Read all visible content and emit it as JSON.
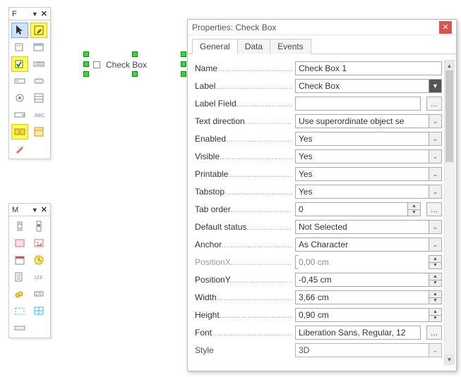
{
  "form_toolbox": {
    "title": "F"
  },
  "more_toolbox": {
    "title": "M"
  },
  "canvas": {
    "checkbox_label": "Check Box"
  },
  "dialog": {
    "title": "Properties: Check Box",
    "tabs": {
      "general": "General",
      "data": "Data",
      "events": "Events"
    },
    "rows": {
      "name": {
        "label": "Name",
        "value": "Check Box 1"
      },
      "label": {
        "label": "Label",
        "value": "Check Box"
      },
      "label_field": {
        "label": "Label Field",
        "value": ""
      },
      "text_dir": {
        "label": "Text direction",
        "value": "Use superordinate object se"
      },
      "enabled": {
        "label": "Enabled",
        "value": "Yes"
      },
      "visible": {
        "label": "Visible",
        "value": "Yes"
      },
      "printable": {
        "label": "Printable",
        "value": "Yes"
      },
      "tabstop": {
        "label": "Tabstop",
        "value": "Yes"
      },
      "tab_order": {
        "label": "Tab order",
        "value": "0"
      },
      "default_status": {
        "label": "Default status",
        "value": "Not Selected"
      },
      "anchor": {
        "label": "Anchor",
        "value": "As Character"
      },
      "pos_x": {
        "label": "PositionX",
        "value": "0,00 cm"
      },
      "pos_y": {
        "label": "PositionY",
        "value": "-0,45 cm"
      },
      "width": {
        "label": "Width",
        "value": "3,66 cm"
      },
      "height": {
        "label": "Height",
        "value": "0,90 cm"
      },
      "font": {
        "label": "Font",
        "value": "Liberation Sans, Regular, 12"
      },
      "style": {
        "label": "Style",
        "value": "3D"
      }
    }
  }
}
